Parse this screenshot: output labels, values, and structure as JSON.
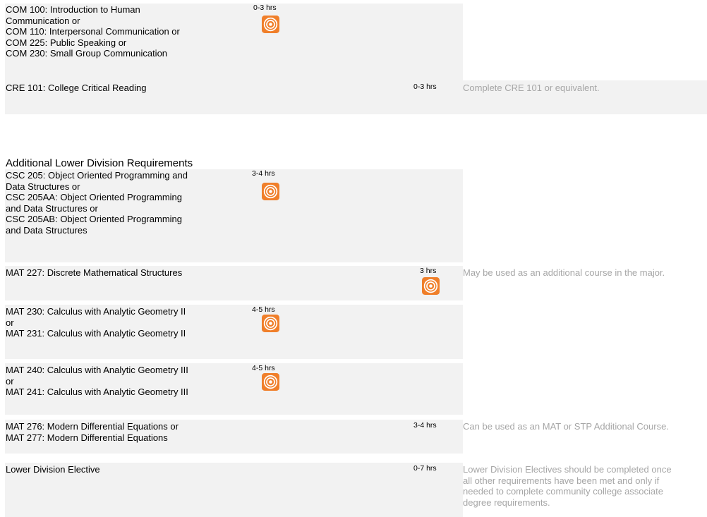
{
  "rows": [
    {
      "courses": "COM 100: Introduction to Human\nCommunication or\nCOM 110: Interpersonal Communication or\nCOM 225: Public Speaking or\nCOM 230: Small Group Communication",
      "hours": "0-3 hrs",
      "icon": "target-icon",
      "note": ""
    },
    {
      "courses": "CRE 101: College Critical Reading",
      "hours": "0-3 hrs",
      "note": "Complete CRE 101 or equivalent."
    }
  ],
  "section": {
    "title": "Additional Lower Division Requirements"
  },
  "rows2": [
    {
      "courses": "CSC 205: Object Oriented Programming and\nData Structures or\nCSC 205AA: Object Oriented Programming\nand Data Structures or\nCSC 205AB: Object Oriented Programming\nand Data Structures",
      "hours": "3-4 hrs",
      "icon": "target-icon"
    },
    {
      "courses": "MAT 227: Discrete Mathematical Structures",
      "hours": "3 hrs",
      "icon": "target-icon",
      "note": "May be used as an additional course in the major."
    },
    {
      "courses": "MAT 230: Calculus with Analytic Geometry II\nor\nMAT 231: Calculus with Analytic Geometry II",
      "hours": "4-5 hrs",
      "icon": "target-icon"
    },
    {
      "courses": "MAT 240: Calculus with Analytic Geometry III\nor\nMAT 241: Calculus with Analytic Geometry III",
      "hours": "4-5 hrs",
      "icon": "target-icon"
    },
    {
      "courses": "MAT 276: Modern Differential Equations or\nMAT 277: Modern Differential Equations",
      "hours": "3-4 hrs",
      "note": "Can be used as an MAT or STP Additional Course."
    },
    {
      "courses": "Lower Division Elective",
      "hours": "0-7 hrs",
      "note": "Lower Division Electives should be completed once all other requirements have been met and only if needed to complete community college associate degree requirements."
    }
  ],
  "colors": {
    "row_bg": "#f2f2f2",
    "note_text": "#a6a6a6",
    "icon_orange": "#f07f2a"
  }
}
